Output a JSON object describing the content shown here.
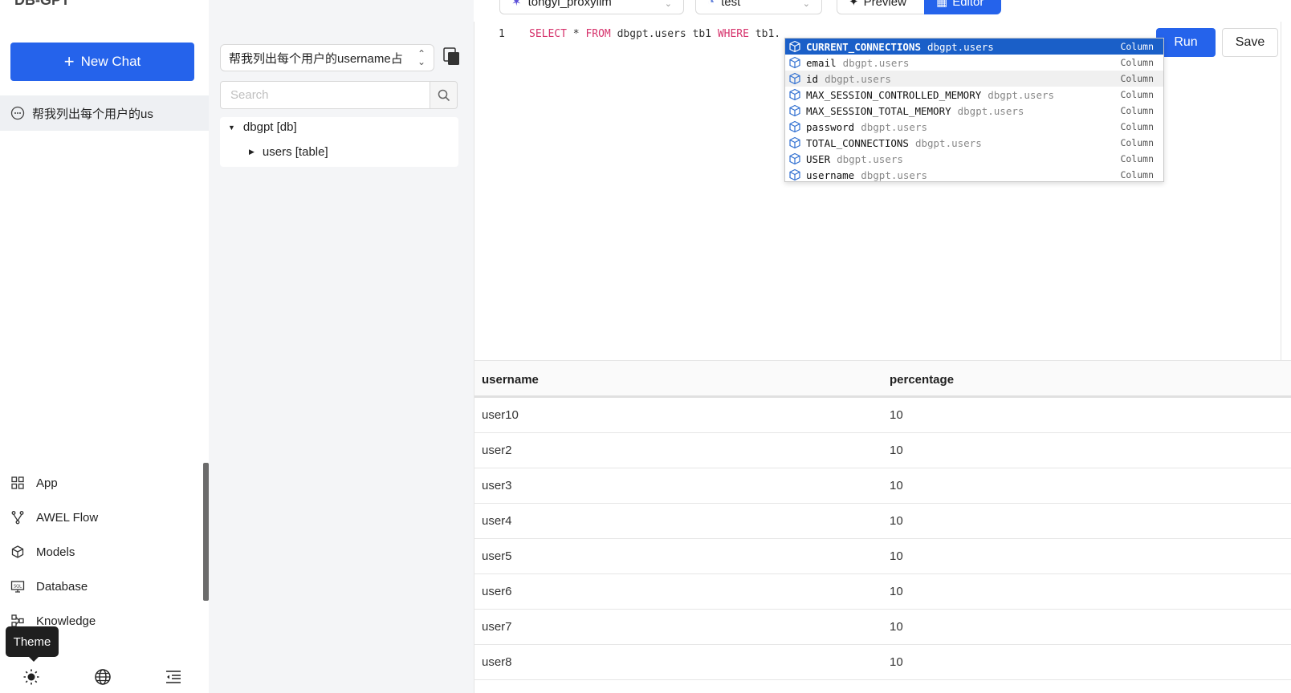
{
  "app": {
    "brand": "DB-GPT"
  },
  "sidebar": {
    "new_chat_label": "New Chat",
    "chat_item_label": "帮我列出每个用户的us",
    "menu": [
      {
        "label": "App",
        "icon": "app-grid-icon"
      },
      {
        "label": "AWEL Flow",
        "icon": "flow-branch-icon"
      },
      {
        "label": "Models",
        "icon": "cube-icon"
      },
      {
        "label": "Database",
        "icon": "database-monitor-icon"
      },
      {
        "label": "Knowledge",
        "icon": "knowledge-graph-icon"
      }
    ],
    "tooltip": "Theme",
    "bottom_icons": [
      "theme-sun-icon",
      "language-globe-icon",
      "collapse-menu-icon"
    ]
  },
  "toolbar": {
    "model_select": "tongyi_proxyllm",
    "db_select": "test",
    "preview_label": "Preview",
    "editor_label": "Editor"
  },
  "query_panel": {
    "selected_query": "帮我列出每个用户的username占",
    "search_placeholder": "Search",
    "tree": {
      "db_label": "dbgpt [db]",
      "table_label": "users [table]"
    }
  },
  "editor": {
    "line_number": "1",
    "code": {
      "select": "SELECT",
      "star": "*",
      "from": "FROM",
      "table": "dbgpt.users tb1",
      "where": "WHERE",
      "tail": "tb1."
    },
    "run_label": "Run",
    "save_label": "Save"
  },
  "autocomplete": {
    "items": [
      {
        "name": "CURRENT_CONNECTIONS",
        "table": "dbgpt.users",
        "kind": "Column"
      },
      {
        "name": "email",
        "table": "dbgpt.users",
        "kind": "Column"
      },
      {
        "name": "id",
        "table": "dbgpt.users",
        "kind": "Column"
      },
      {
        "name": "MAX_SESSION_CONTROLLED_MEMORY",
        "table": "dbgpt.users",
        "kind": "Column"
      },
      {
        "name": "MAX_SESSION_TOTAL_MEMORY",
        "table": "dbgpt.users",
        "kind": "Column"
      },
      {
        "name": "password",
        "table": "dbgpt.users",
        "kind": "Column"
      },
      {
        "name": "TOTAL_CONNECTIONS",
        "table": "dbgpt.users",
        "kind": "Column"
      },
      {
        "name": "USER",
        "table": "dbgpt.users",
        "kind": "Column"
      },
      {
        "name": "username",
        "table": "dbgpt.users",
        "kind": "Column"
      }
    ]
  },
  "results": {
    "columns": [
      "username",
      "percentage"
    ],
    "rows": [
      [
        "user10",
        "10"
      ],
      [
        "user2",
        "10"
      ],
      [
        "user3",
        "10"
      ],
      [
        "user4",
        "10"
      ],
      [
        "user5",
        "10"
      ],
      [
        "user6",
        "10"
      ],
      [
        "user7",
        "10"
      ],
      [
        "user8",
        "10"
      ]
    ]
  },
  "colors": {
    "primary": "#2563eb",
    "suggest_selected": "#1a5fc8",
    "sql_keyword": "#d6336c"
  }
}
